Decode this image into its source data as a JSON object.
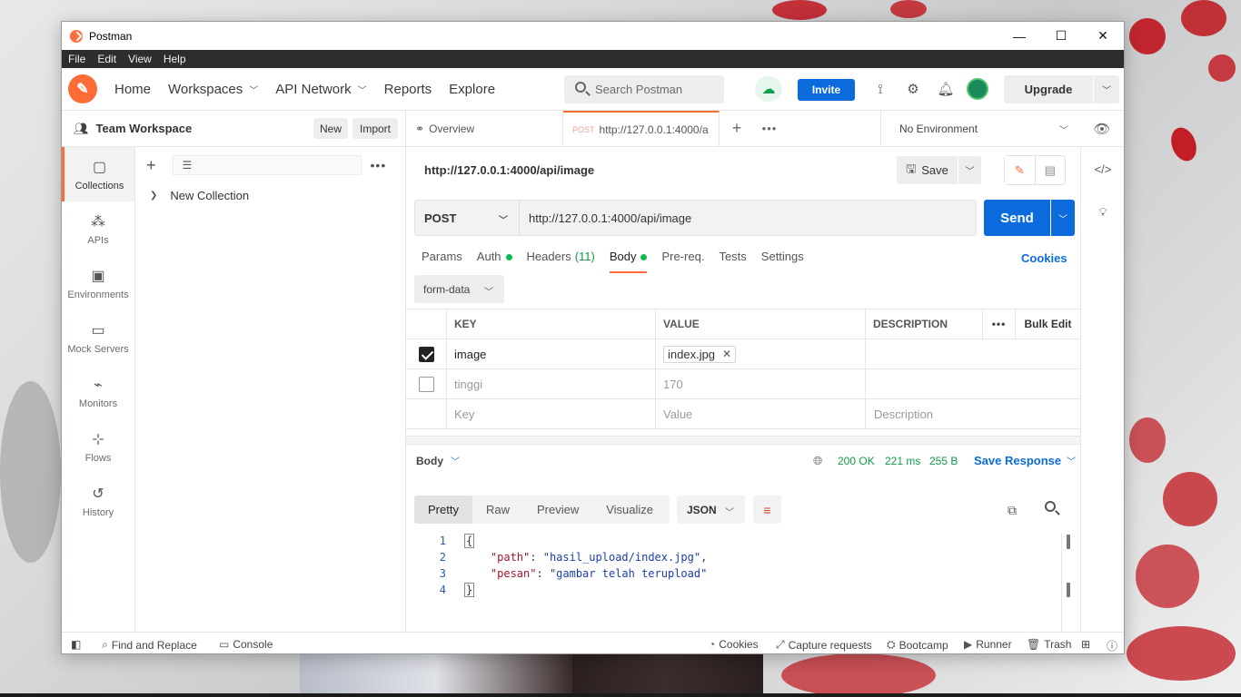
{
  "window": {
    "title": "Postman",
    "controls": [
      "—",
      "☐",
      "✕"
    ]
  },
  "menu": [
    "File",
    "Edit",
    "View",
    "Help"
  ],
  "header": {
    "nav": [
      {
        "label": "Home",
        "chevron": false
      },
      {
        "label": "Workspaces",
        "chevron": true
      },
      {
        "label": "API Network",
        "chevron": true
      },
      {
        "label": "Reports",
        "chevron": false
      },
      {
        "label": "Explore",
        "chevron": false
      }
    ],
    "search_placeholder": "Search Postman",
    "invite_label": "Invite",
    "upgrade_label": "Upgrade"
  },
  "workspace": {
    "name": "Team Workspace",
    "new_label": "New",
    "import_label": "Import"
  },
  "leftnav": [
    {
      "label": "Collections",
      "icon": "▢",
      "active": true
    },
    {
      "label": "APIs",
      "icon": "⁂",
      "active": false
    },
    {
      "label": "Environments",
      "icon": "▣",
      "active": false
    },
    {
      "label": "Mock Servers",
      "icon": "▭",
      "active": false
    },
    {
      "label": "Monitors",
      "icon": "⌁",
      "active": false
    },
    {
      "label": "Flows",
      "icon": "⊹",
      "active": false
    },
    {
      "label": "History",
      "icon": "↺",
      "active": false
    }
  ],
  "sidebar": {
    "collection_name": "New Collection"
  },
  "tabs": {
    "overview": "Overview",
    "active_method": "POST",
    "active_url": "http://127.0.0.1:4000/a"
  },
  "environment": {
    "label": "No Environment"
  },
  "request": {
    "name": "http://127.0.0.1:4000/api/image",
    "save_label": "Save",
    "method": "POST",
    "url": "http://127.0.0.1:4000/api/image",
    "send_label": "Send",
    "subtabs": [
      {
        "label": "Params"
      },
      {
        "label": "Auth",
        "dot": true
      },
      {
        "label": "Headers",
        "count": "(11)"
      },
      {
        "label": "Body",
        "dot": true,
        "active": true
      },
      {
        "label": "Pre-req."
      },
      {
        "label": "Tests"
      },
      {
        "label": "Settings"
      }
    ],
    "cookies_label": "Cookies",
    "body_mode": "form-data",
    "table": {
      "headers": {
        "key": "KEY",
        "value": "VALUE",
        "description": "DESCRIPTION",
        "bulk": "Bulk Edit"
      },
      "rows": [
        {
          "checked": true,
          "key": "image",
          "value": "index.jpg",
          "file": true
        },
        {
          "checked": false,
          "key": "tinggi",
          "value": "170",
          "file": false
        }
      ],
      "placeholders": {
        "key": "Key",
        "value": "Value",
        "description": "Description"
      }
    }
  },
  "response": {
    "body_label": "Body",
    "status": "200 OK",
    "time": "221 ms",
    "size": "255 B",
    "save_label": "Save Response",
    "views": [
      "Pretty",
      "Raw",
      "Preview",
      "Visualize"
    ],
    "format": "JSON",
    "lines": [
      {
        "num": "1",
        "text": "{"
      },
      {
        "num": "2",
        "key": "\"path\"",
        "value": "\"hasil_upload/index.jpg\"",
        "comma": ","
      },
      {
        "num": "3",
        "key": "\"pesan\"",
        "value": "\"gambar telah terupload\"",
        "comma": ""
      },
      {
        "num": "4",
        "text": "}"
      }
    ]
  },
  "statusbar": {
    "find_replace": "Find and Replace",
    "console": "Console",
    "cookies": "Cookies",
    "capture": "Capture requests",
    "bootcamp": "Bootcamp",
    "runner": "Runner",
    "trash": "Trash"
  },
  "colors": {
    "accent": "#ff6c37",
    "primary": "#0b6bdc",
    "success": "#0d9c47"
  }
}
